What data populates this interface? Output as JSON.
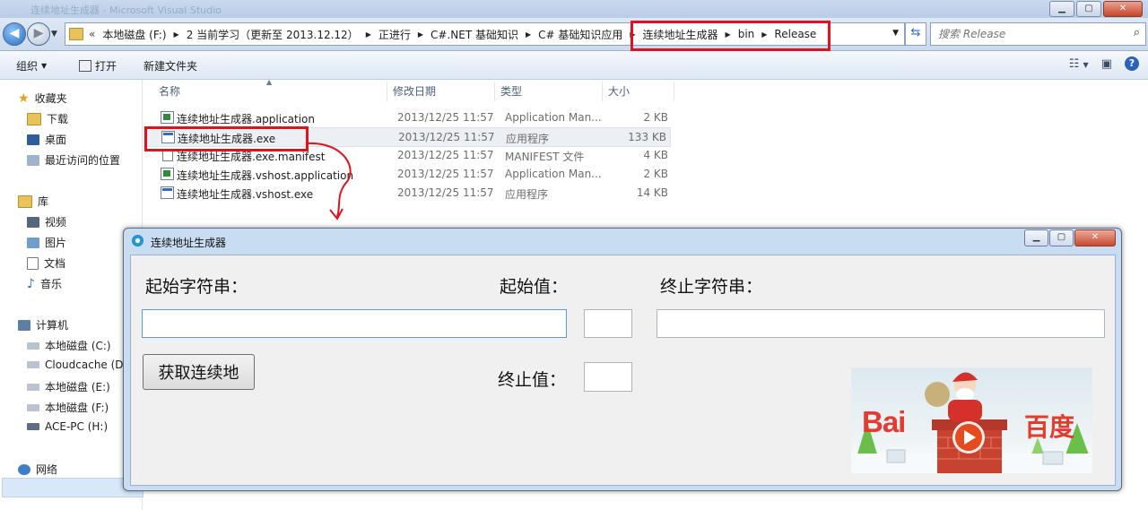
{
  "window": {
    "title_ghost": "连续地址生成器 - Microsoft Visual Studio",
    "minimize_glyph": "▁",
    "maximize_glyph": "▢",
    "close_glyph": "✕"
  },
  "nav": {
    "back_glyph": "◀",
    "forward_glyph": "▶",
    "history_glyph": "▼",
    "refresh_glyph": "⇆"
  },
  "address": {
    "more_glyph": "«",
    "separator_glyph": "▶",
    "dropdown_glyph": "▼",
    "crumbs": [
      "本地磁盘 (F:)",
      "2 当前学习（更新至 2013.12.12）",
      "正进行",
      "C#.NET 基础知识",
      "C# 基础知识应用",
      "连续地址生成器",
      "bin",
      "Release"
    ]
  },
  "search": {
    "placeholder": "搜索 Release",
    "icon_glyph": "⌕"
  },
  "toolbar": {
    "organize_label": "组织",
    "organize_arrow": "▼",
    "open_label": "打开",
    "new_folder_label": "新建文件夹",
    "view_glyph": "☷",
    "view_arrow": "▼",
    "preview_glyph": "▣",
    "help_glyph": "?"
  },
  "navpane": {
    "favorites": {
      "label": "收藏夹",
      "items": [
        "下载",
        "桌面",
        "最近访问的位置"
      ]
    },
    "libraries": {
      "label": "库",
      "items": [
        "视频",
        "图片",
        "文档",
        "音乐"
      ]
    },
    "computer": {
      "label": "计算机",
      "items": [
        "本地磁盘 (C:)",
        "Cloudcache (D:",
        "本地磁盘 (E:)",
        "本地磁盘 (F:)",
        "ACE-PC (H:)"
      ]
    },
    "network": {
      "label": "网络"
    },
    "selected_item": "本地磁盘 (F:)"
  },
  "filelist": {
    "sort_glyph": "▲",
    "columns": {
      "name": "名称",
      "date": "修改日期",
      "type": "类型",
      "size": "大小"
    },
    "rows": [
      {
        "name": "连续地址生成器.application",
        "date": "2013/12/25 11:57",
        "type": "Application Man...",
        "size": "2 KB",
        "icon": "application-icon"
      },
      {
        "name": "连续地址生成器.exe",
        "date": "2013/12/25 11:57",
        "type": "应用程序",
        "size": "133 KB",
        "icon": "exe-icon"
      },
      {
        "name": "连续地址生成器.exe.manifest",
        "date": "2013/12/25 11:57",
        "type": "MANIFEST 文件",
        "size": "4 KB",
        "icon": "document-icon"
      },
      {
        "name": "连续地址生成器.vshost.application",
        "date": "2013/12/25 11:57",
        "type": "Application Man...",
        "size": "2 KB",
        "icon": "application-icon"
      },
      {
        "name": "连续地址生成器.vshost.exe",
        "date": "2013/12/25 11:57",
        "type": "应用程序",
        "size": "14 KB",
        "icon": "exe-icon"
      }
    ]
  },
  "annotation_color": "#e0121d",
  "appwin": {
    "title": "连续地址生成器",
    "minimize_glyph": "▁",
    "maximize_glyph": "▢",
    "close_glyph": "✕",
    "start_string_label": "起始字符串：",
    "start_value_label": "起始值：",
    "end_string_label": "终止字符串：",
    "end_value_label": "终止值：",
    "generate_button": "获取连续地",
    "start_string_value": "",
    "start_value": "",
    "end_string_value": "",
    "end_value": "",
    "baidu": {
      "logo_left": "Bai",
      "logo_right": "百度",
      "colors": {
        "red": "#e53a2e",
        "blue": "#2f5fd0"
      }
    }
  }
}
